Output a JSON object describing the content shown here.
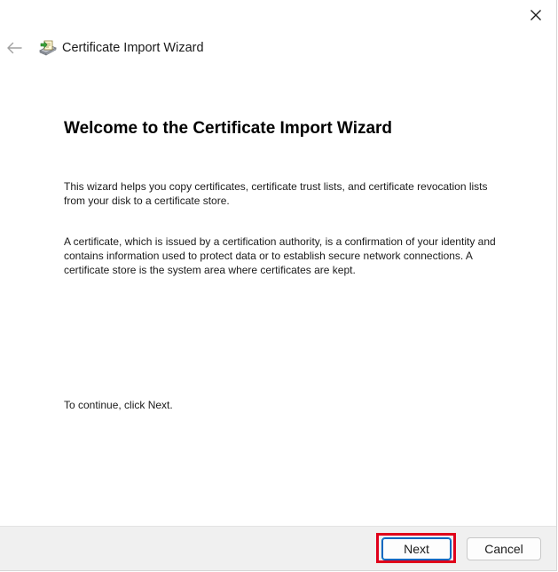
{
  "window": {
    "close_icon": "close-icon"
  },
  "header": {
    "back_icon": "back-arrow-icon",
    "wizard_icon": "certificate-icon",
    "title": "Certificate Import Wizard"
  },
  "main": {
    "heading": "Welcome to the Certificate Import Wizard",
    "paragraph1": "This wizard helps you copy certificates, certificate trust lists, and certificate revocation lists from your disk to a certificate store.",
    "paragraph2": "A certificate, which is issued by a certification authority, is a confirmation of your identity and contains information used to protect data or to establish secure network connections. A certificate store is the system area where certificates are kept.",
    "paragraph3": "To continue, click Next."
  },
  "footer": {
    "next_label": "Next",
    "cancel_label": "Cancel"
  },
  "colors": {
    "highlight": "#e0001b",
    "accent": "#0067c0",
    "footer_bg": "#f0f0f0"
  }
}
